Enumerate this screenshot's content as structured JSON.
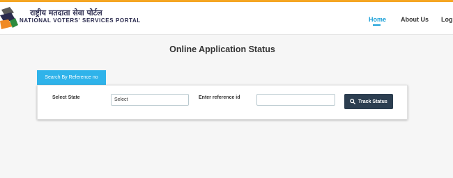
{
  "brand": {
    "hindi_name": "राष्ट्रीय मतदाता सेवा पोर्टल",
    "english_name": "NATIONAL VOTERS' SERVICES PORTAL",
    "logo_icon": "voting-ink-finger-icon"
  },
  "nav": {
    "home": "Home",
    "about": "About Us",
    "login": "Login"
  },
  "page": {
    "title": "Online Application Status"
  },
  "tab": {
    "label": "Search By Reference no"
  },
  "form": {
    "state_label": "Select State",
    "state_value": "Select",
    "reference_label": "Enter reference id",
    "reference_value": "",
    "track_button_label": "Track Status",
    "track_button_icon": "search-icon"
  },
  "colors": {
    "accent": "#1aa0d8",
    "tab_bg": "#2fb3ea",
    "button_bg": "#2c3e50"
  }
}
